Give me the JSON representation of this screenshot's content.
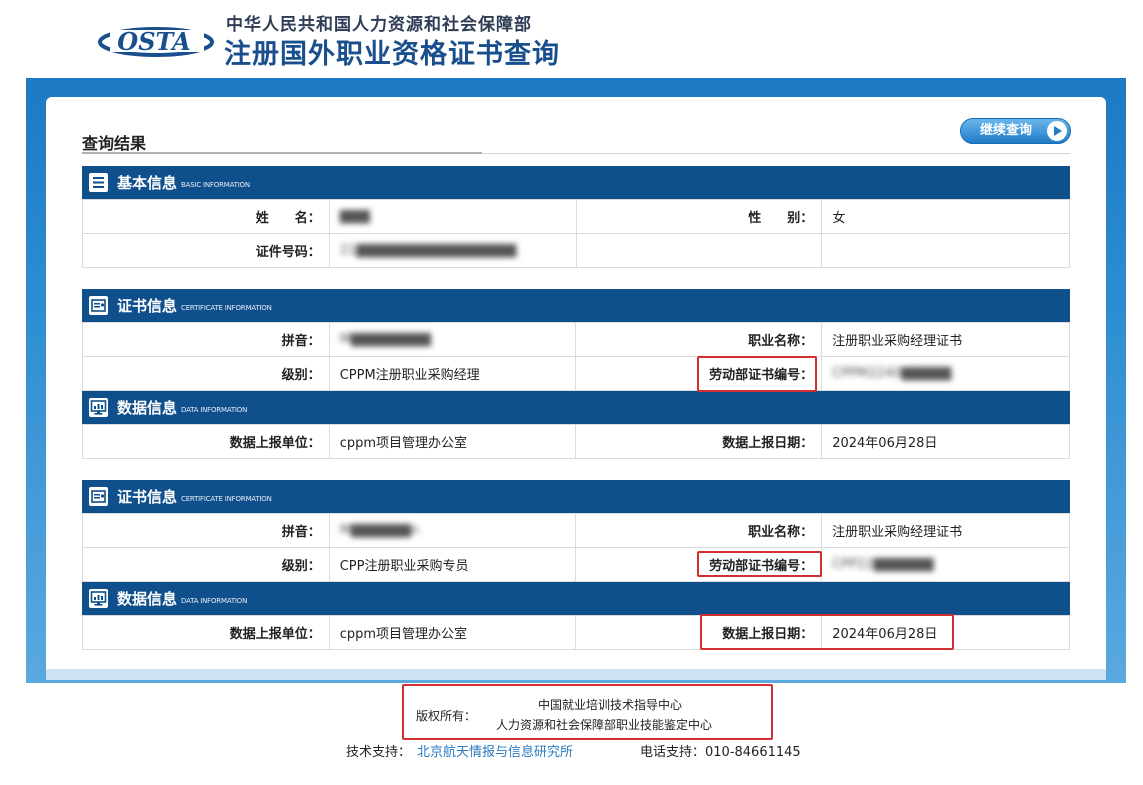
{
  "header": {
    "logo_text": "OSTA",
    "org_line": "中华人民共和国人力资源和社会保障部",
    "site_title": "注册国外职业资格证书查询"
  },
  "result": {
    "title": "查询结果",
    "continue_button": "继续查询"
  },
  "basic": {
    "title": "基本信息",
    "subtitle": "BASIC INFORMATION",
    "name_label": "姓　　名：",
    "name_value": "▇▇▇",
    "gender_label": "性　　别：",
    "gender_value": "女",
    "id_label": "证件号码：",
    "id_value": "21▇▇▇▇▇▇▇▇▇▇▇▇▇▇▇▇"
  },
  "certificates": [
    {
      "title": "证书信息",
      "subtitle": "CERTIFICATE INFORMATION",
      "pinyin_label": "拼音：",
      "pinyin_value": "M▇▇▇▇▇▇▇▇",
      "occupation_label": "职业名称：",
      "occupation_value": "注册职业采购经理证书",
      "level_label": "级别：",
      "level_value": "CPPM注册职业采购经理",
      "cert_no_label": "劳动部证书编号：",
      "cert_no_value": "CPPM2240▇▇▇▇▇",
      "data_title": "数据信息",
      "data_subtitle": "DATA INFORMATION",
      "unit_label": "数据上报单位：",
      "unit_value": "cppm项目管理办公室",
      "date_label": "数据上报日期：",
      "date_value": "2024年06月28日"
    },
    {
      "title": "证书信息",
      "subtitle": "CERTIFICATE INFORMATION",
      "pinyin_label": "拼音：",
      "pinyin_value": "M▇▇▇▇▇▇n",
      "occupation_label": "职业名称：",
      "occupation_value": "注册职业采购经理证书",
      "level_label": "级别：",
      "level_value": "CPP注册职业采购专员",
      "cert_no_label": "劳动部证书编号：",
      "cert_no_value": "CPP22▇▇▇▇▇▇",
      "data_title": "数据信息",
      "data_subtitle": "DATA INFORMATION",
      "unit_label": "数据上报单位：",
      "unit_value": "cppm项目管理办公室",
      "date_label": "数据上报日期：",
      "date_value": "2024年06月28日"
    }
  ],
  "footer": {
    "copyright_label": "版权所有：",
    "copyright_org1": "中国就业培训技术指导中心",
    "copyright_org2": "人力资源和社会保障部职业技能鉴定中心",
    "tech_label": "技术支持：",
    "tech_link": "北京航天情报与信息研究所",
    "phone": "电话支持：010-84661145"
  },
  "colors": {
    "section_header": "#0e4f8c",
    "frame": "#2f8ed3",
    "highlight": "#d23030",
    "link": "#2a7bbf"
  }
}
